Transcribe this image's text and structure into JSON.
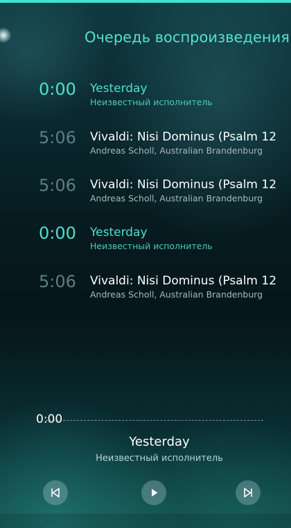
{
  "header": {
    "title": "Очередь воспроизведения"
  },
  "queue": [
    {
      "duration": "0:00",
      "title": "Yesterday",
      "artist": "Неизвестный исполнитель",
      "current": true
    },
    {
      "duration": "5:06",
      "title": "Vivaldi: Nisi Dominus (Psalm 12",
      "artist": "Andreas Scholl, Australian Brandenburg",
      "current": false
    },
    {
      "duration": "5:06",
      "title": "Vivaldi: Nisi Dominus (Psalm 12",
      "artist": "Andreas Scholl, Australian Brandenburg",
      "current": false
    },
    {
      "duration": "0:00",
      "title": "Yesterday",
      "artist": "Неизвестный исполнитель",
      "current": true
    },
    {
      "duration": "5:06",
      "title": "Vivaldi: Nisi Dominus (Psalm 12",
      "artist": "Andreas Scholl, Australian Brandenburg",
      "current": false
    }
  ],
  "player": {
    "elapsed": "0:00",
    "title": "Yesterday",
    "artist": "Неизвестный исполнитель",
    "controls": {
      "previous_icon": "skip-previous-icon",
      "play_icon": "play-icon",
      "next_icon": "skip-next-icon"
    }
  },
  "colors": {
    "accent": "#4fe0cf",
    "top_bar": "#3fe3d2",
    "inactive_duration": "#5e7e82"
  }
}
